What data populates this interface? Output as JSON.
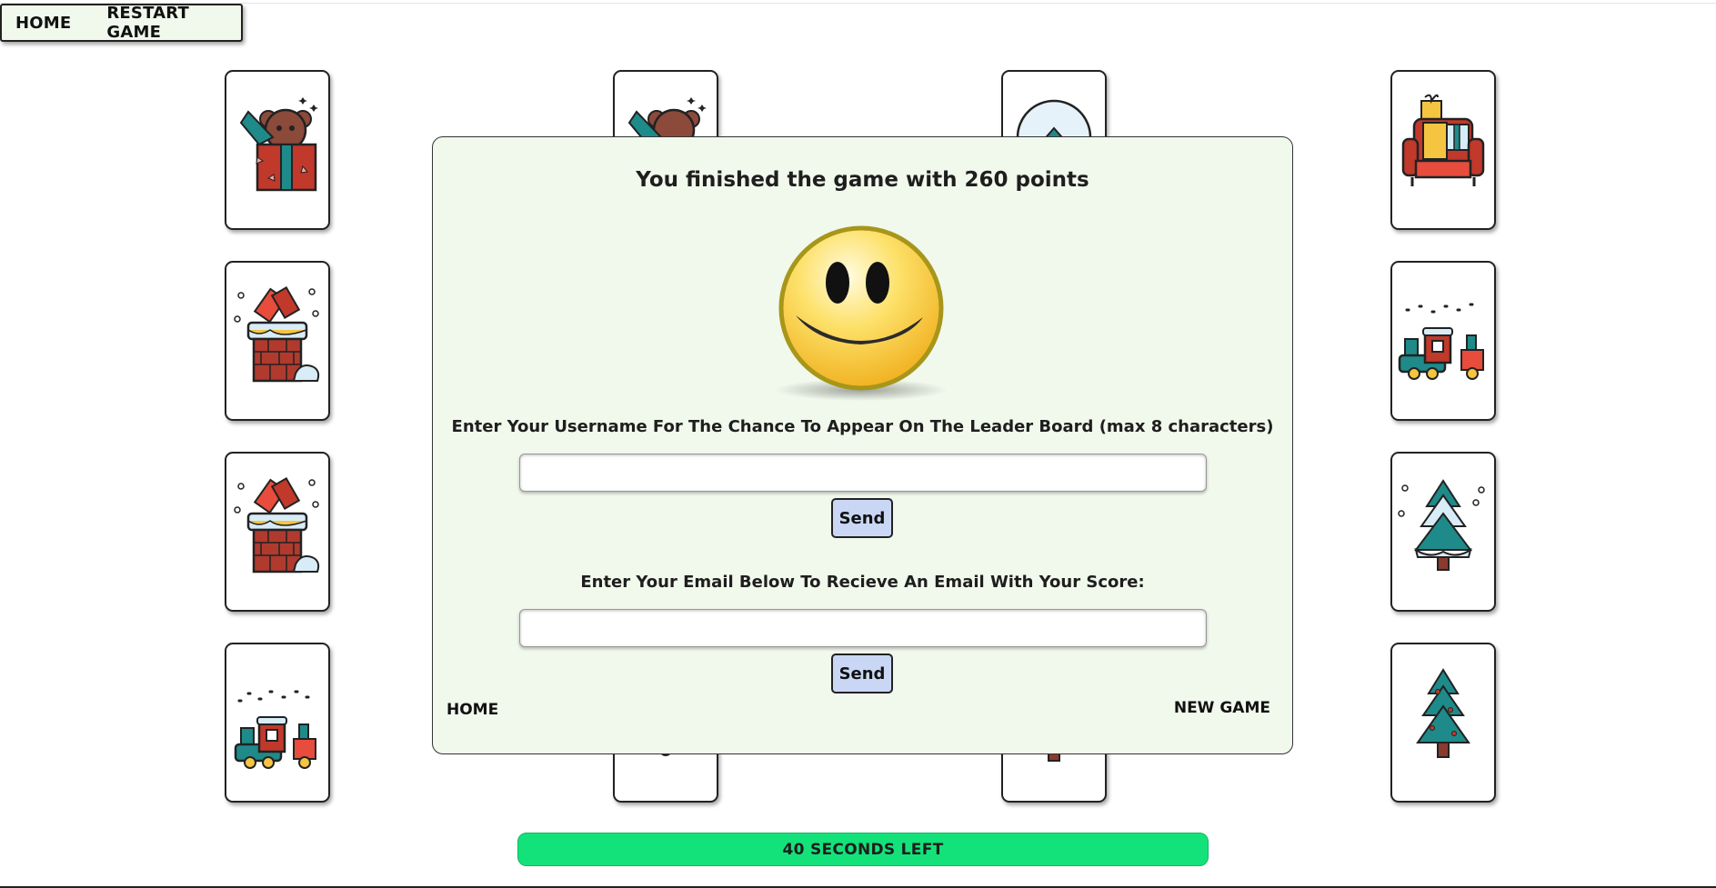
{
  "nav": {
    "home_label": "HOME",
    "restart_label": "RESTART GAME"
  },
  "cards": [
    {
      "icon": "teddy-bear-gift-icon"
    },
    {
      "icon": "teddy-bear-gift-icon"
    },
    {
      "icon": "snow-globe-icon"
    },
    {
      "icon": "armchair-gifts-icon"
    },
    {
      "icon": "chimney-gift-icon"
    },
    {
      "icon": "toy-train-icon"
    },
    {
      "icon": "chimney-gift-icon"
    },
    {
      "icon": "snowy-tree-icon"
    },
    {
      "icon": "toy-train-icon"
    },
    {
      "icon": "bell-icon"
    },
    {
      "icon": "tree-trunk-icon"
    },
    {
      "icon": "christmas-tree-icon"
    }
  ],
  "modal": {
    "title": "You finished the game with 260 points",
    "smiley_icon": "smiley-face-icon",
    "username_prompt": "Enter Your Username For The Chance To Appear On The Leader Board (max 8 characters)",
    "username_value": "",
    "send_label": "Send",
    "email_prompt": "Enter Your Email Below To Recieve An Email With Your Score:",
    "email_value": "",
    "home_label": "HOME",
    "new_game_label": "NEW GAME"
  },
  "timer": {
    "label": "40 SECONDS LEFT",
    "color": "#13e27a"
  }
}
